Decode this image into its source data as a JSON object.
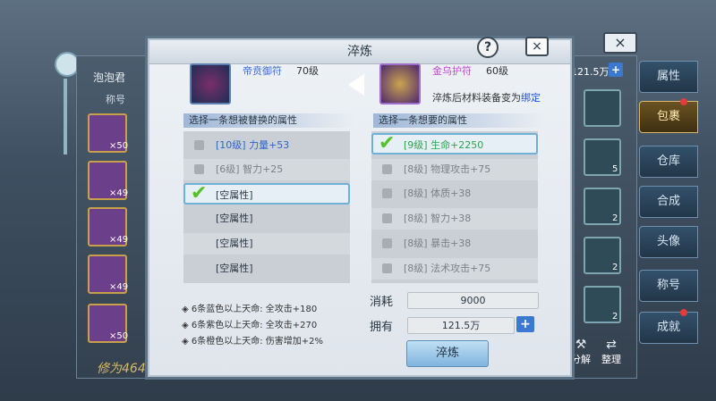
{
  "background": {
    "left_name": "泡泡君",
    "left_tab": "称号",
    "power_text": "修为464",
    "currency": "121.5万",
    "tabs": [
      "属性",
      "包裹",
      "仓库",
      "合成",
      "头像",
      "称号",
      "成就"
    ],
    "active_tab": "包裹",
    "left_slot_counts": [
      "×50",
      "×49",
      "×49",
      "×49",
      "×50"
    ],
    "right_slot_counts": [
      "5",
      "2",
      "2",
      "2"
    ],
    "bottom_buttons": [
      "分解",
      "整理"
    ]
  },
  "dialog": {
    "title": "淬炼",
    "help_icon": "?",
    "close_icon": "×",
    "outer_close_icon": "×",
    "source_item": {
      "name": "帝贲御符",
      "level": "70级"
    },
    "target_item": {
      "name": "金乌护符",
      "level": "60级"
    },
    "bind_note_prefix": "淬炼后材料装备变为",
    "bind_note_highlight": "绑定",
    "left_header": "选择一条想被替换的属性",
    "right_header": "选择一条想要的属性",
    "left_rows": [
      {
        "text": "[10级] 力量+53"
      },
      {
        "text": "[6级] 智力+25"
      },
      {
        "text": "[空属性]"
      },
      {
        "text": "[空属性]"
      },
      {
        "text": "[空属性]"
      },
      {
        "text": "[空属性]"
      }
    ],
    "right_rows": [
      {
        "text": "[9级] 生命+2250"
      },
      {
        "text": "[8级] 物理攻击+75"
      },
      {
        "text": "[8级] 体质+38"
      },
      {
        "text": "[8级] 智力+38"
      },
      {
        "text": "[8级] 暴击+38"
      },
      {
        "text": "[8级] 法术攻击+75"
      }
    ],
    "suit_bonuses": [
      "6条蓝色以上天命: 全攻击+180",
      "6条紫色以上天命: 全攻击+270",
      "6条橙色以上天命: 伤害增加+2%"
    ],
    "cost_label": "消耗",
    "cost_value": "9000",
    "owned_label": "拥有",
    "owned_value": "121.5万",
    "plus": "+",
    "confirm_label": "淬炼"
  },
  "colors": {
    "accent_blue": "#3b79d0",
    "selected_green": "#2ea44f",
    "bind_blue": "#1c55d8",
    "target_name_purple": "#c04bd4"
  }
}
